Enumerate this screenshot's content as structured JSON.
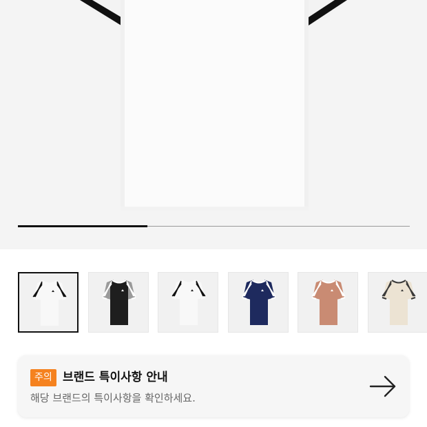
{
  "hero": {
    "image_name": "white-tshirt-main-image",
    "carousel_progress": 0.33
  },
  "thumbnails": [
    {
      "name": "white-black-stripes",
      "body": "#f8f8f8",
      "sleeve": "#f8f8f8",
      "stripe": "#111111",
      "accent": "#f8f8f8",
      "logo": "#222222",
      "selected": true
    },
    {
      "name": "black-white-stripes",
      "body": "#1e1e1e",
      "sleeve": "#9a9a9a",
      "stripe": "#ffffff",
      "accent": "#ffffff",
      "logo": "#ffffff",
      "selected": false
    },
    {
      "name": "white-black-stripes-2",
      "body": "#f8f8f8",
      "sleeve": "#f8f8f8",
      "stripe": "#111111",
      "accent": "#f8f8f8",
      "logo": "#222222",
      "selected": false
    },
    {
      "name": "navy-white-stripes",
      "body": "#1e2a5e",
      "sleeve": "#1e2a5e",
      "stripe": "#ffffff",
      "accent": "#ffffff",
      "logo": "#ffffff",
      "selected": false
    },
    {
      "name": "terracotta-white-stripes",
      "body": "#c98b73",
      "sleeve": "#c98b73",
      "stripe": "#ffffff",
      "accent": "#ffffff",
      "logo": "#ffffff",
      "selected": false
    },
    {
      "name": "cream-dark-stripes",
      "body": "#ece3d3",
      "sleeve": "#ece3d3",
      "stripe": "#3a3a3a",
      "accent": "#3a3a3a",
      "logo": "#3a3a3a",
      "selected": false
    }
  ],
  "notice": {
    "badge": "주의",
    "title": "브랜드 특이사항 안내",
    "description": "해당 브랜드의 특이사항을 확인하세요.",
    "arrow_icon": "arrow-right-icon",
    "badge_color": "#f5821f"
  }
}
